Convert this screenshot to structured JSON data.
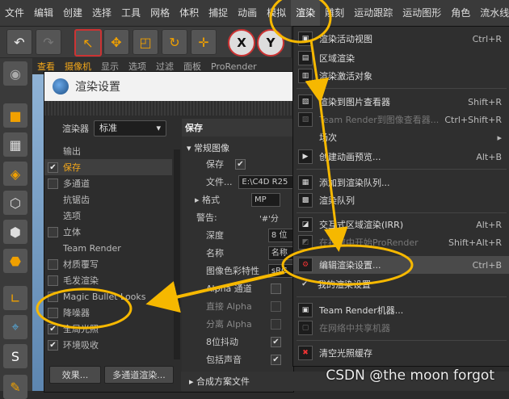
{
  "menubar": {
    "items": [
      "文件",
      "编辑",
      "创建",
      "选择",
      "工具",
      "网格",
      "体积",
      "捕捉",
      "动画",
      "模拟",
      "渲染",
      "雕刻",
      "运动跟踪",
      "运动图形",
      "角色",
      "流水线"
    ],
    "active_index": 10
  },
  "toolbar": {
    "undo_icon": "undo-icon",
    "redo_icon": "redo-icon",
    "axis_x": "X",
    "axis_y": "Y"
  },
  "subtabs": [
    "查看",
    "摄像机",
    "显示",
    "选项",
    "过滤",
    "面板",
    "ProRender"
  ],
  "render_settings": {
    "title": "渲染设置",
    "renderer_label": "渲染器",
    "renderer_value": "标准",
    "tree": [
      {
        "label": "输出",
        "checked": null,
        "selected": false
      },
      {
        "label": "保存",
        "checked": true,
        "selected": true
      },
      {
        "label": "多通道",
        "checked": false,
        "selected": false
      },
      {
        "label": "抗锯齿",
        "checked": null,
        "selected": false
      },
      {
        "label": "选项",
        "checked": null,
        "selected": false
      },
      {
        "label": "立体",
        "checked": false,
        "selected": false
      },
      {
        "label": "Team Render",
        "checked": null,
        "selected": false
      },
      {
        "label": "材质覆写",
        "checked": false,
        "selected": false
      },
      {
        "label": "毛发渲染",
        "checked": false,
        "selected": false
      },
      {
        "label": "Magic Bullet Looks",
        "checked": false,
        "selected": false
      },
      {
        "label": "降噪器",
        "checked": false,
        "selected": false
      },
      {
        "label": "全局光照",
        "checked": true,
        "selected": false
      },
      {
        "label": "环境吸收",
        "checked": true,
        "selected": false
      }
    ],
    "effects_button": "效果...",
    "multipass_button": "多通道渲染...",
    "panel": {
      "header": "保存",
      "section": "常规图像",
      "save_label": "保存",
      "file_label": "文件...",
      "file_value": "E:\\C4D R25 ",
      "format_label": "格式",
      "format_value": "MP",
      "warning_label": "警告:",
      "warning_value": "'#'分",
      "depth_label": "深度",
      "depth_value": "8 位",
      "name_label": "名称",
      "name_value": "名称",
      "colorprofile_label": "图像色彩特性",
      "colorprofile_value": "sRG",
      "alpha_label": "Alpha 通道",
      "straight_alpha_label": "直接 Alpha",
      "separate_alpha_label": "分离 Alpha",
      "dither_label": "8位抖动",
      "sound_label": "包括声音",
      "composite_label": "合成方案文件"
    }
  },
  "render_menu": {
    "items": [
      {
        "label": "渲染活动视图",
        "shortcut": "Ctrl+R",
        "dim": false,
        "icon": "render-view-icon"
      },
      {
        "label": "区域渲染",
        "shortcut": "",
        "dim": false,
        "icon": "region-render-icon"
      },
      {
        "label": "渲染激活对象",
        "shortcut": "",
        "dim": false,
        "icon": "render-active-icon"
      },
      {
        "label": "渲染到图片查看器",
        "shortcut": "Shift+R",
        "dim": false,
        "icon": "picture-viewer-icon"
      },
      {
        "label": "Team Render到图像查看器...",
        "shortcut": "Ctrl+Shift+R",
        "dim": true,
        "icon": "team-render-icon"
      },
      {
        "label": "场次",
        "shortcut": "",
        "dim": false,
        "icon": "",
        "submenu": true
      },
      {
        "label": "创建动画预览...",
        "shortcut": "Alt+B",
        "dim": false,
        "icon": "anim-preview-icon"
      },
      {
        "label": "添加到渲染队列...",
        "shortcut": "",
        "dim": false,
        "icon": "add-queue-icon"
      },
      {
        "label": "渲染队列",
        "shortcut": "",
        "dim": false,
        "icon": "render-queue-icon"
      },
      {
        "label": "交互式区域渲染(IRR)",
        "shortcut": "Alt+R",
        "dim": false,
        "icon": "irr-icon"
      },
      {
        "label": "在视窗中开始ProRender",
        "shortcut": "Shift+Alt+R",
        "dim": true,
        "icon": "prorender-icon"
      },
      {
        "label": "编辑渲染设置...",
        "shortcut": "Ctrl+B",
        "dim": false,
        "icon": "edit-render-settings-icon",
        "highlight": true
      },
      {
        "label": "我的渲染设置",
        "shortcut": "",
        "dim": false,
        "icon": "my-render-settings-icon"
      },
      {
        "label": "Team Render机器...",
        "shortcut": "",
        "dim": false,
        "icon": "team-machines-icon"
      },
      {
        "label": "在网络中共享机器",
        "shortcut": "",
        "dim": true,
        "icon": "share-network-icon"
      },
      {
        "label": "清空光照缓存",
        "shortcut": "",
        "dim": false,
        "icon": "flush-cache-icon"
      }
    ]
  },
  "watermark": "CSDN @the moon forgot",
  "colors": {
    "accent": "#f3a71a",
    "annotation": "#f6b800"
  }
}
